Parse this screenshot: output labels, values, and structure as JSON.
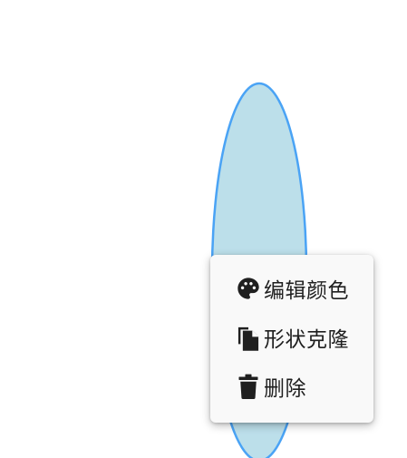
{
  "shape": {
    "type": "ellipse",
    "fill_color": "#bcdfea",
    "stroke_color": "#4aa3f5"
  },
  "context_menu": {
    "items": [
      {
        "label": "编辑颜色",
        "icon": "palette-icon"
      },
      {
        "label": "形状克隆",
        "icon": "copy-icon"
      },
      {
        "label": "删除",
        "icon": "trash-icon"
      }
    ]
  }
}
